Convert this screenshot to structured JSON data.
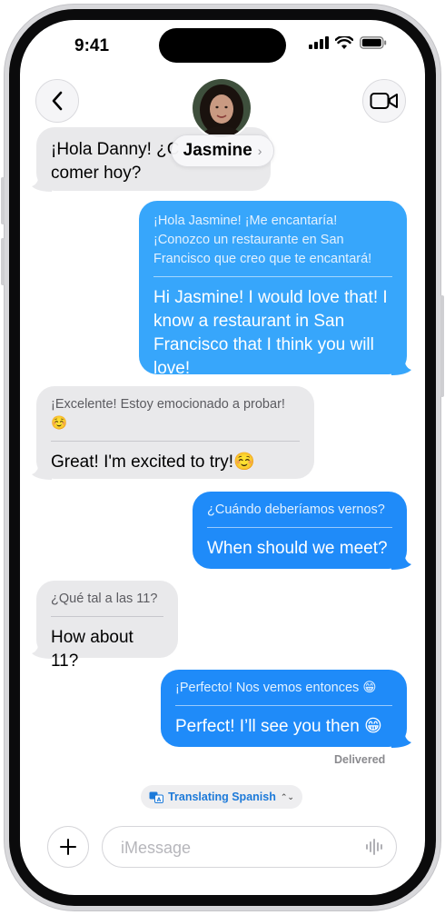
{
  "status_bar": {
    "time": "9:41"
  },
  "header": {
    "contact_name": "Jasmine",
    "name_chevron": "›"
  },
  "messages": [
    {
      "partial_text": "¡Hola Danny! ¿C",
      "translation": "comer hoy?"
    },
    {
      "original": "¡Hola Jasmine! ¡Me encantaría! ¡Conozco un restaurante en San Francisco que creo que te encantará!",
      "translation": "Hi Jasmine! I would love that! I know a restaurant in San Francisco that I think you will love!"
    },
    {
      "original": "¡Excelente! Estoy emocionado a probar! ☺️",
      "translation": "Great! I'm excited to try!☺️"
    },
    {
      "original": "¿Cuándo deberíamos vernos?",
      "translation": "When should we meet?"
    },
    {
      "original": "¿Qué tal a las 11?",
      "translation": "How about 11?"
    },
    {
      "original": "¡Perfecto! Nos vemos entonces 😁",
      "translation": "Perfect! I’ll see you then 😁"
    }
  ],
  "delivered_label": "Delivered",
  "translating": {
    "label": "Translating Spanish",
    "chevron": "⌃⌄"
  },
  "composer": {
    "placeholder": "iMessage"
  }
}
